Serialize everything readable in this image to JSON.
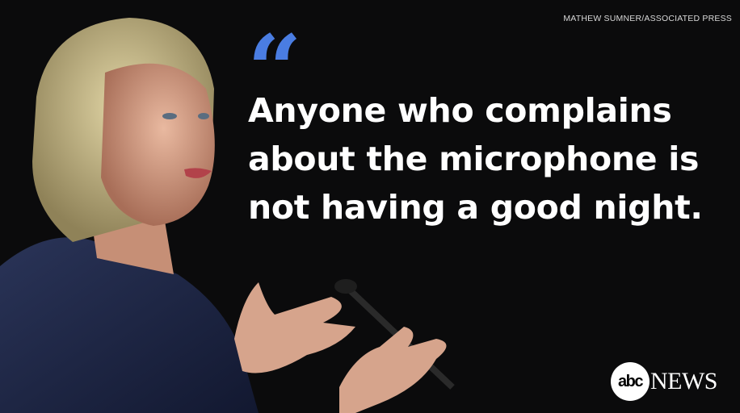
{
  "credit": "MATHEW SUMNER/ASSOCIATED PRESS",
  "quote_mark": "“",
  "quote_lines": [
    "Anyone who complains",
    "about the microphone is",
    "not having a good night."
  ],
  "logo": {
    "abc": "abc",
    "news": "NEWS"
  },
  "colors": {
    "accent": "#4a7de2",
    "background": "#0b0b0c",
    "text": "#ffffff"
  }
}
